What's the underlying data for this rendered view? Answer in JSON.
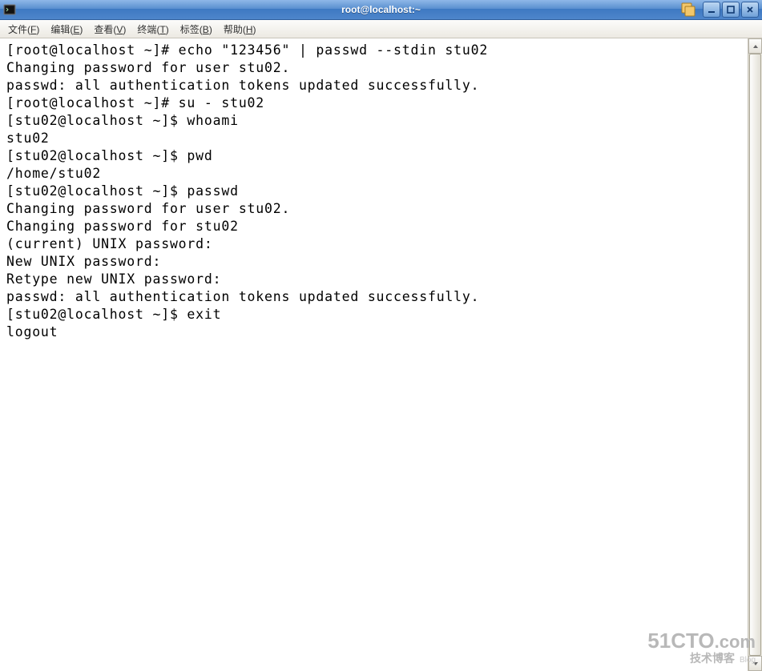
{
  "window": {
    "title": "root@localhost:~"
  },
  "menu": {
    "file": {
      "label": "文件",
      "accel": "F"
    },
    "edit": {
      "label": "编辑",
      "accel": "E"
    },
    "view": {
      "label": "查看",
      "accel": "V"
    },
    "term": {
      "label": "终端",
      "accel": "T"
    },
    "tabs": {
      "label": "标签",
      "accel": "B"
    },
    "help": {
      "label": "帮助",
      "accel": "H"
    }
  },
  "terminal_lines": [
    "[root@localhost ~]# echo \"123456\" | passwd --stdin stu02",
    "Changing password for user stu02.",
    "passwd: all authentication tokens updated successfully.",
    "[root@localhost ~]# su - stu02",
    "[stu02@localhost ~]$ whoami",
    "stu02",
    "[stu02@localhost ~]$ pwd",
    "/home/stu02",
    "[stu02@localhost ~]$ passwd",
    "Changing password for user stu02.",
    "Changing password for stu02",
    "(current) UNIX password:",
    "New UNIX password:",
    "Retype new UNIX password:",
    "passwd: all authentication tokens updated successfully.",
    "[stu02@localhost ~]$ exit",
    "logout"
  ],
  "watermark": {
    "main": "51CTO",
    "suffix": ".com",
    "sub": "技术博客",
    "sub_small": "Blog"
  }
}
